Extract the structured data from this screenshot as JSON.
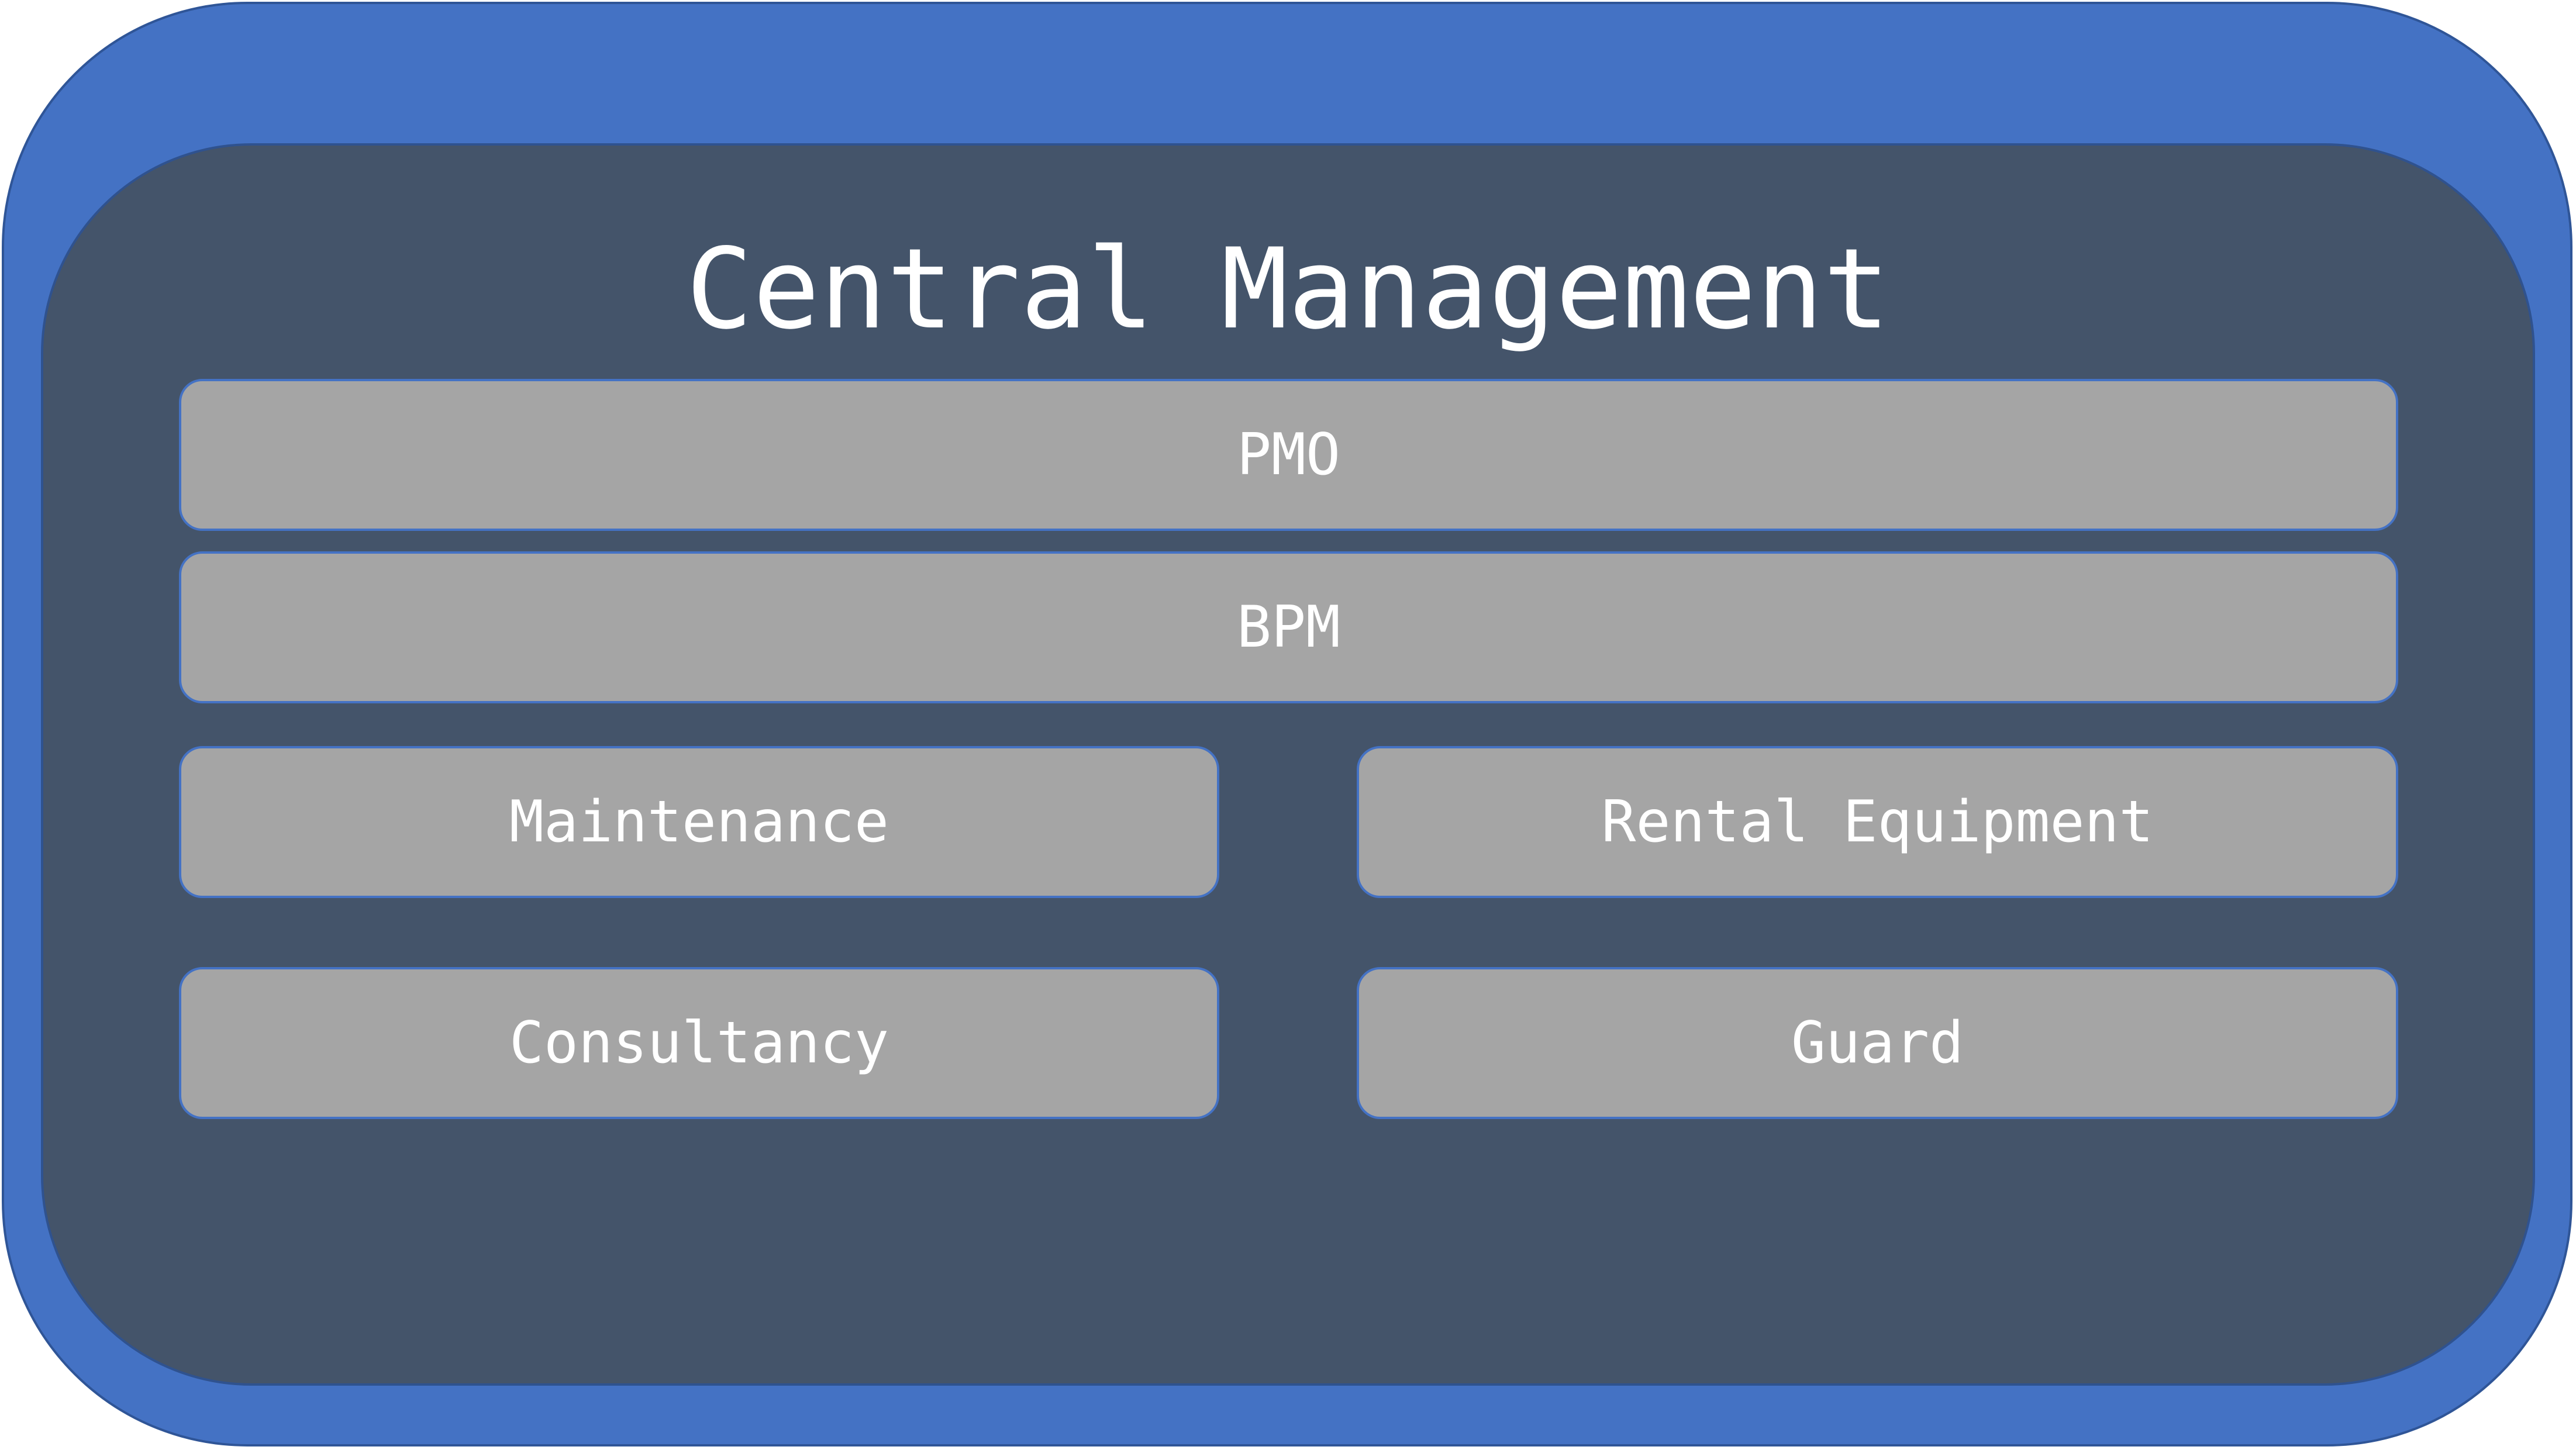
{
  "diagram": {
    "title": "Central Management",
    "boxes": {
      "pmo": "PMO",
      "bpm": "BPM",
      "maintenance": "Maintenance",
      "rental_equipment": "Rental Equipment",
      "consultancy": "Consultancy",
      "guard": "Guard"
    }
  },
  "colors": {
    "outer_fill": "#4472c4",
    "inner_fill": "#44546a",
    "box_fill": "#a5a5a5",
    "text": "#ffffff"
  }
}
